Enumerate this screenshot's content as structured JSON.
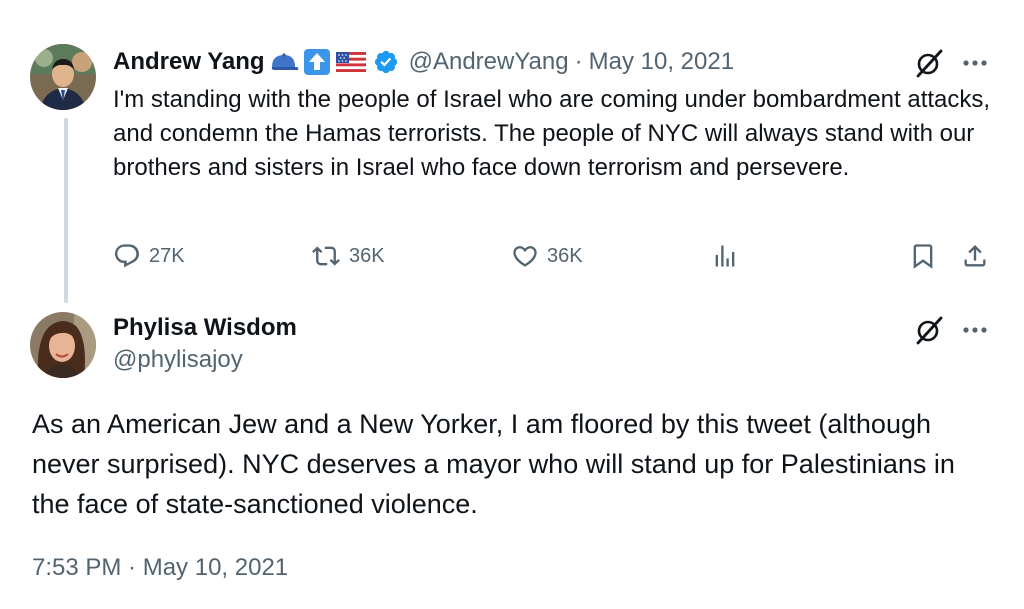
{
  "parent_tweet": {
    "name": "Andrew Yang",
    "emojis": [
      "cap-emoji",
      "up-arrow-emoji",
      "us-flag-emoji"
    ],
    "handle": "@AndrewYang",
    "separator": "·",
    "date": "May 10, 2021",
    "text": "I'm standing with the people of Israel who are coming under bombardment attacks, and condemn the Hamas terrorists. The people of NYC will always stand with our brothers and sisters in Israel who face down terrorism and persevere.",
    "stats": {
      "replies": "27K",
      "reposts": "36K",
      "likes": "36K"
    }
  },
  "reply_tweet": {
    "name": "Phylisa Wisdom",
    "handle": "@phylisajoy",
    "text": "As an American Jew and a New Yorker, I am floored by this tweet (although never surprised). NYC deserves a mayor who will stand up for Palestinians in the face of state-sanctioned violence.",
    "timestamp": "7:53 PM · May 10, 2021"
  },
  "colors": {
    "verified": "#1d9bf0",
    "secondary_text": "#536471",
    "thread_line": "#cfd9de"
  },
  "icons": [
    "reply-icon",
    "repost-icon",
    "like-icon",
    "views-icon",
    "bookmark-icon",
    "share-icon",
    "grok-icon",
    "more-icon"
  ]
}
